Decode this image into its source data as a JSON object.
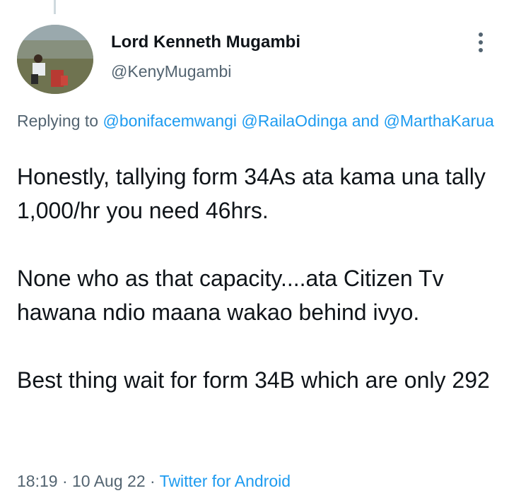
{
  "author": {
    "display_name": "Lord Kenneth Mugambi",
    "handle": "@KenyMugambi"
  },
  "reply": {
    "prefix": "Replying to",
    "mentions": [
      "@bonifacemwangi",
      "@RailaOdinga"
    ],
    "conjunction": "and",
    "last_mention": "@MarthaKarua"
  },
  "tweet": {
    "paragraphs": [
      "Honestly, tallying form 34As ata kama una tally 1,000/hr you need 46hrs.",
      "None who as that capacity....ata Citizen Tv hawana ndio maana wakao behind ivyo.",
      "Best thing wait for form 34B which are only 292"
    ]
  },
  "meta": {
    "time": "18:19",
    "separator": "·",
    "date": "10 Aug 22",
    "source": "Twitter for Android"
  },
  "icons": {
    "more": "more-vertical-icon"
  },
  "colors": {
    "link": "#1d9bf0",
    "secondary_text": "#536471",
    "primary_text": "#0f1419"
  }
}
